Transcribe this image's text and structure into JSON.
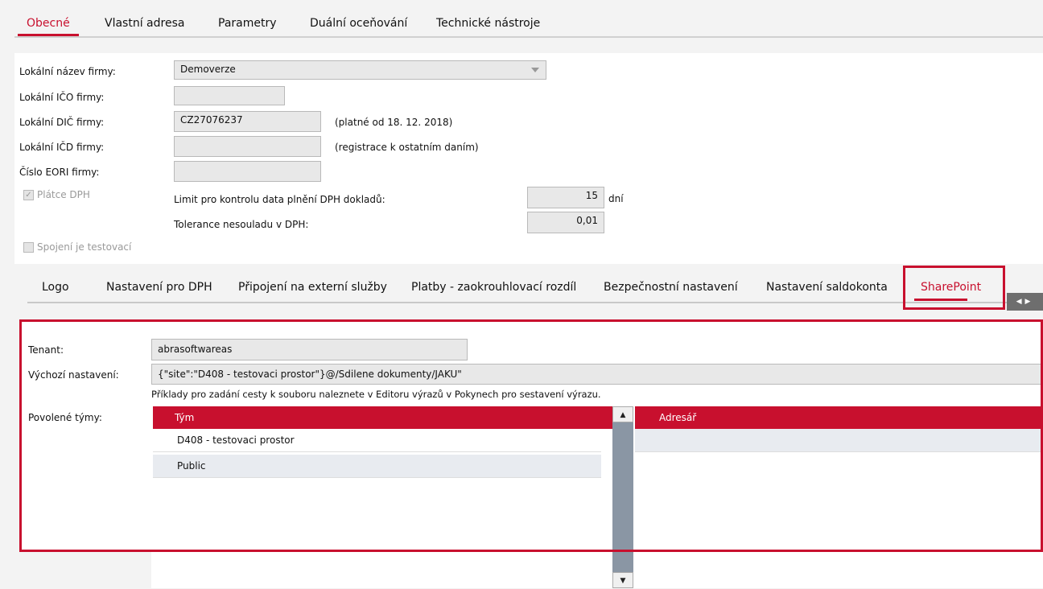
{
  "top_tabs": [
    "Obecné",
    "Vlastní adresa",
    "Parametry",
    "Duální oceňování",
    "Technické nástroje"
  ],
  "form": {
    "company_name_label": "Lokální název firmy:",
    "company_name_value": "Demoverze",
    "ico_label": "Lokální IČO firmy:",
    "ico_value": "",
    "dic_label": "Lokální DIČ firmy:",
    "dic_value": "CZ27076237",
    "dic_note": "(platné od 18. 12. 2018)",
    "icd_label": "Lokální IČD firmy:",
    "icd_value": "",
    "icd_note": "(registrace k ostatním daním)",
    "eori_label": "Číslo EORI firmy:",
    "eori_value": "",
    "vat_payer_label": "Plátce DPH",
    "vat_payer_checked": true,
    "limit_label": "Limit pro kontrolu data plnění DPH dokladů:",
    "limit_value": "15",
    "limit_unit": "dní",
    "tolerance_label": "Tolerance nesouladu v DPH:",
    "tolerance_value": "0,01",
    "test_conn_label": "Spojení je testovací",
    "test_conn_checked": false
  },
  "bottom_tabs": [
    "Logo",
    "Nastavení pro DPH",
    "Připojení na externí služby",
    "Platby - zaokrouhlovací rozdíl",
    "Bezpečnostní nastavení",
    "Nastavení saldokonta",
    "SharePoint"
  ],
  "sharepoint": {
    "tenant_label": "Tenant:",
    "tenant_value": "abrasoftwareas",
    "default_label": "Výchozí nastavení:",
    "default_value": "{\"site\":\"D408 - testovaci prostor\"}@/Sdilene dokumenty/JAKU\"",
    "hint": "Příklady pro zadání cesty k souboru naleznete v Editoru výrazů v Pokynech pro sestavení výrazu.",
    "teams_label": "Povolené týmy:",
    "team_col": "Tým",
    "folder_col": "Adresář",
    "teams": [
      "D408 - testovaci prostor",
      "Public"
    ]
  },
  "colors": {
    "accent": "#c8102e",
    "panel_bg": "#f3f3f3"
  }
}
